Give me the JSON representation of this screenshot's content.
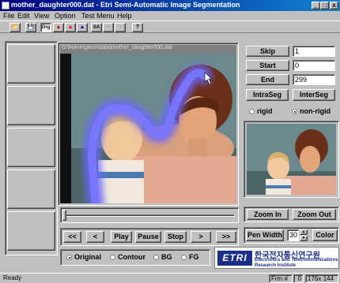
{
  "window": {
    "title": "mother_daughter000.dat - Etri Semi-Automatic Image Segmentation",
    "min_glyph": "_",
    "max_glyph": "□",
    "close_glyph": "x"
  },
  "menu": [
    "File",
    "Edit",
    "View",
    "Option",
    "Test Menu",
    "Help"
  ],
  "toolbar": {
    "items": [
      {
        "name": "open-icon",
        "glyph": "📂"
      },
      {
        "name": "save-icon",
        "glyph": "💾"
      },
      {
        "name": "original-icon",
        "glyph": "Org"
      },
      {
        "name": "segment-icon-1",
        "glyph": "▲"
      },
      {
        "name": "segment-icon-2",
        "glyph": "▲"
      },
      {
        "name": "segment-icon-3",
        "glyph": "▲"
      },
      {
        "name": "select-all-icon",
        "glyph": "SA"
      },
      {
        "name": "disabled-icon-1",
        "glyph": "▫"
      },
      {
        "name": "disabled-icon-2",
        "glyph": "▫"
      },
      {
        "name": "help-icon",
        "glyph": "?"
      }
    ]
  },
  "viewer": {
    "path": "D:\\home\\gleon\\data\\mother_daughter000.dat"
  },
  "controls": {
    "skip_label": "Skip",
    "skip_value": "1",
    "start_label": "Start",
    "start_value": "0",
    "end_label": "End",
    "end_value": "299",
    "intraseg_label": "IntraSeg",
    "interseg_label": "InterSeg",
    "rigid_label": "rigid",
    "nonrigid_label": "non-rigid",
    "zoom_in_label": "Zoom In",
    "zoom_out_label": "Zoom Out",
    "pen_width_label": "Pen Width",
    "pen_width_value": "30",
    "color_label": "Color"
  },
  "playback": [
    "<<",
    "<",
    "Play",
    "Pause",
    "Stop",
    ">",
    ">>"
  ],
  "view_mode": {
    "options": [
      "Original",
      "Contour",
      "BG",
      "FG"
    ],
    "selected": "Original"
  },
  "logo": {
    "brand": "ETRI",
    "korean": "한국전자통신연구원",
    "line1": "Electronics and Telecommunications",
    "line2": "Research Institute"
  },
  "status": {
    "text": "Ready",
    "frame_label": "Frm #",
    "frame_value": "0",
    "size": "176x 144"
  }
}
